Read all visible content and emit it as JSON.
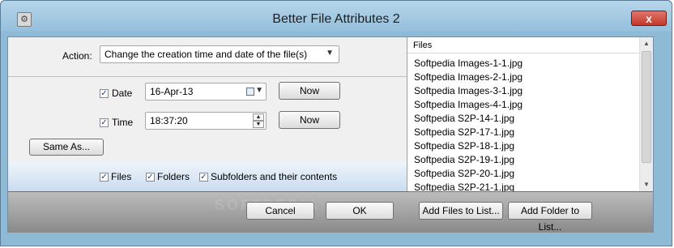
{
  "window": {
    "title": "Better File Attributes 2",
    "close_label": "x"
  },
  "action": {
    "label": "Action:",
    "selected": "Change the creation time and date of the file(s)"
  },
  "date": {
    "label": "Date",
    "value": "16-Apr-13",
    "now_label": "Now"
  },
  "time": {
    "label": "Time",
    "value": "18:37:20",
    "now_label": "Now"
  },
  "same_as_label": "Same As...",
  "options": {
    "files_label": "Files",
    "folders_label": "Folders",
    "subfolders_label": "Subfolders and their contents"
  },
  "files_list": {
    "header": "Files",
    "items": [
      "Softpedia Images-1-1.jpg",
      "Softpedia Images-2-1.jpg",
      "Softpedia Images-3-1.jpg",
      "Softpedia Images-4-1.jpg",
      "Softpedia S2P-14-1.jpg",
      "Softpedia S2P-17-1.jpg",
      "Softpedia S2P-18-1.jpg",
      "Softpedia S2P-19-1.jpg",
      "Softpedia S2P-20-1.jpg",
      "Softpedia S2P-21-1.jpg"
    ]
  },
  "buttons": {
    "cancel": "Cancel",
    "ok": "OK",
    "add_files": "Add Files to List...",
    "add_folder": "Add Folder to List..."
  },
  "watermark": "SOFTPEDIA",
  "icons": {
    "app": "app-icon",
    "calendar": "calendar-dropdown-icon",
    "spinner": "spinner-icon"
  }
}
